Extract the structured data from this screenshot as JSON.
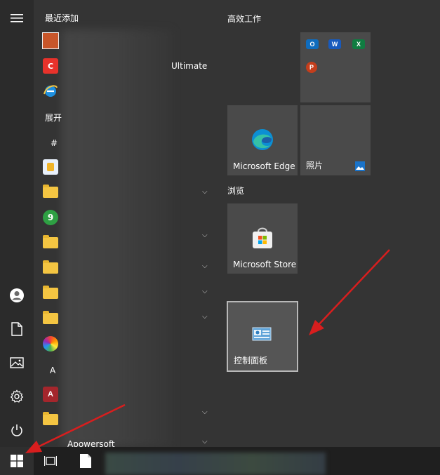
{
  "rail": {
    "icons": [
      "hamburger-menu-icon",
      "user-avatar-icon",
      "documents-icon",
      "pictures-icon",
      "settings-gear-icon",
      "power-icon"
    ]
  },
  "applist": {
    "recent_header": "最近添加",
    "recent_partial_label": "Ultimate",
    "expand_label": "展开",
    "hash_header": "#",
    "a_header": "A",
    "bottom_partial_label": "Apowersoft"
  },
  "tiles": {
    "group_productivity": "高效工作",
    "group_browse": "浏览",
    "edge_label": "Microsoft Edge",
    "photos_label": "照片",
    "store_label": "Microsoft Store",
    "control_panel_label": "控制面板",
    "office_mini": {
      "outlook": "O",
      "word": "W",
      "excel": "X",
      "powerpoint": "P"
    }
  },
  "colors": {
    "annotation_arrow": "#d81e1e",
    "folder": "#f4c542",
    "menu_bg": "#343434",
    "tile_bg": "#4a4a4a"
  }
}
